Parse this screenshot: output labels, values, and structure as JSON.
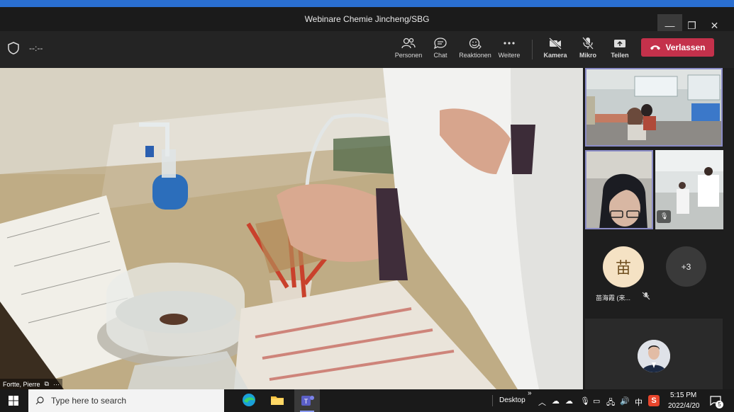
{
  "window": {
    "title": "Webinare Chemie Jincheng/SBG",
    "minimize": "—",
    "restore": "❐",
    "close": "✕"
  },
  "meeting": {
    "timer": "--:--"
  },
  "toolbar": {
    "people": "Personen",
    "chat": "Chat",
    "reactions": "Reaktionen",
    "more": "Weitere",
    "camera": "Kamera",
    "mic": "Mikro",
    "share": "Teilen",
    "leave": "Verlassen"
  },
  "stage": {
    "name": "Fortte, Pierre",
    "more": "···"
  },
  "participants": {
    "avatar_initial": "苗",
    "avatar_name": "苗海霞 (来...",
    "overflow": "+3"
  },
  "taskbar": {
    "search_placeholder": "Type here to search",
    "desktop": "Desktop",
    "time": "5:15 PM",
    "date": "2022/4/20",
    "ime": "中",
    "notif_count": "5"
  }
}
